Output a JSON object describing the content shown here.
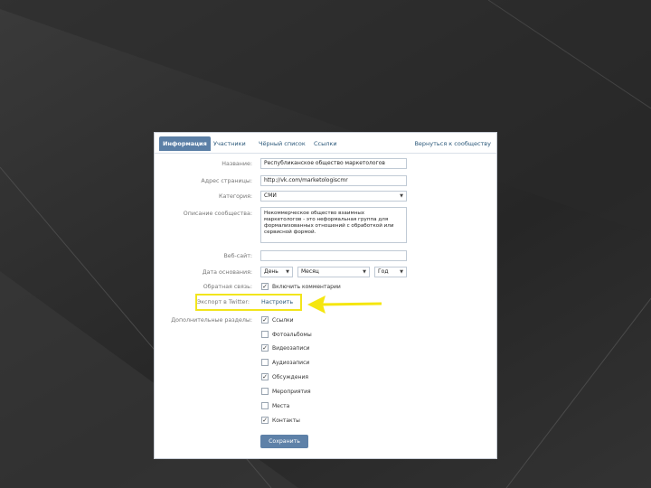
{
  "tabs": [
    {
      "label": "Информация"
    },
    {
      "label": "Участники"
    },
    {
      "label": "Чёрный список"
    },
    {
      "label": "Ссылки"
    }
  ],
  "back_link": "Вернуться к сообществу",
  "form": {
    "name": {
      "label": "Название:",
      "value": "Республиканское общество маркетологов"
    },
    "address": {
      "label": "Адрес страницы:",
      "value": "http://vk.com/marketologiscmr"
    },
    "category": {
      "label": "Категория:",
      "value": "СМИ"
    },
    "description": {
      "label": "Описание сообщества:",
      "value": "Некоммерческое общество взаимных маркетологов - это неформальная группа для формализованных отношений с обработкой или сервисной формой."
    },
    "website": {
      "label": "Веб-сайт:",
      "value": ""
    },
    "founded": {
      "label": "Дата основания:",
      "day": "День",
      "month": "Месяц",
      "year": "Год"
    },
    "comments": {
      "label": "Обратная связь:",
      "option": "Включить комментарии"
    },
    "twitter": {
      "label": "Экспорт в Twitter:",
      "link": "Настроить"
    },
    "sections": {
      "label": "Дополнительные разделы:",
      "items": [
        {
          "label": "Ссылки",
          "checked": true
        },
        {
          "label": "Фотоальбомы",
          "checked": false
        },
        {
          "label": "Видеозаписи",
          "checked": true
        },
        {
          "label": "Аудиозаписи",
          "checked": false
        },
        {
          "label": "Обсуждения",
          "checked": true
        },
        {
          "label": "Мероприятия",
          "checked": false
        },
        {
          "label": "Места",
          "checked": false
        },
        {
          "label": "Контакты",
          "checked": true
        }
      ]
    },
    "save_label": "Сохранить"
  },
  "colors": {
    "accent": "#5b7fa6",
    "highlight": "#f2e51c",
    "arrow": "#f5e60f"
  }
}
